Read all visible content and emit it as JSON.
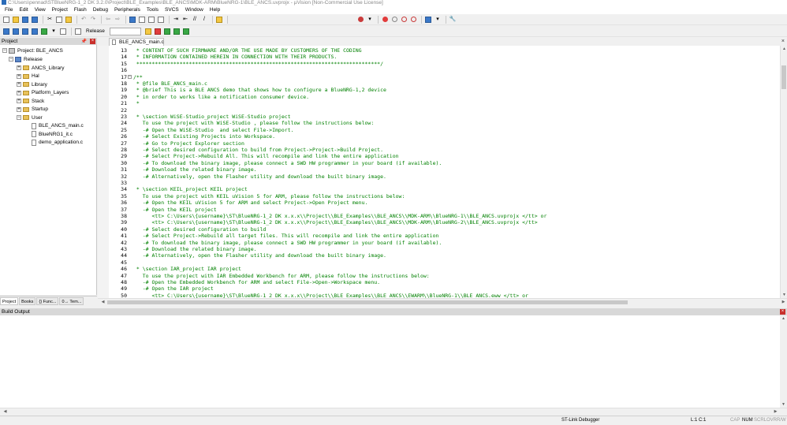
{
  "window": {
    "title": "C:\\Users\\pennad\\STBlueNRG-1_2 DK 3.2.0\\Project\\BLE_Examples\\BLE_ANCS\\MDK-ARM\\BlueNRG-1\\BLE_ANCS.uvprojx - µVision [Non-Commercial Use License]"
  },
  "menu": [
    "File",
    "Edit",
    "View",
    "Project",
    "Flash",
    "Debug",
    "Peripherals",
    "Tools",
    "SVCS",
    "Window",
    "Help"
  ],
  "toolbar": {
    "target_label": "Release"
  },
  "project_panel": {
    "title": "Project",
    "pin_icon": "📌",
    "close_icon": "×",
    "tree": [
      {
        "label": "Project: BLE_ANCS",
        "kind": "project",
        "expander": "−"
      },
      {
        "label": "Release",
        "kind": "target",
        "expander": "−"
      },
      {
        "label": "ANCS_Library",
        "kind": "folder",
        "expander": "+"
      },
      {
        "label": "Hal",
        "kind": "folder",
        "expander": "+"
      },
      {
        "label": "Library",
        "kind": "folder",
        "expander": "+"
      },
      {
        "label": "Platform_Layers",
        "kind": "folder",
        "expander": "+"
      },
      {
        "label": "Stack",
        "kind": "folder",
        "expander": "+"
      },
      {
        "label": "Startup",
        "kind": "folder",
        "expander": "+"
      },
      {
        "label": "User",
        "kind": "folder",
        "expander": "−"
      },
      {
        "label": "BLE_ANCS_main.c",
        "kind": "file",
        "expander": ""
      },
      {
        "label": "BlueNRG1_it.c",
        "kind": "file",
        "expander": ""
      },
      {
        "label": "demo_application.c",
        "kind": "file",
        "expander": ""
      }
    ],
    "tabs": [
      "Project",
      "Books",
      "{} Func...",
      "0→ Tem..."
    ]
  },
  "editor": {
    "tab_label": "BLE_ANCS_main.c",
    "close_icon": "×",
    "lines": [
      {
        "n": "13",
        "t": " * CONTENT OF SUCH FIRMWARE AND/OR THE USE MADE BY CUSTOMERS OF THE CODING"
      },
      {
        "n": "14",
        "t": " * INFORMATION CONTAINED HEREIN IN CONNECTION WITH THEIR PRODUCTS."
      },
      {
        "n": "15",
        "t": " *******************************************************************************/"
      },
      {
        "n": "16",
        "t": ""
      },
      {
        "n": "17",
        "t": "/**",
        "fold": "−"
      },
      {
        "n": "18",
        "t": " * @file BLE_ANCS_main.c"
      },
      {
        "n": "19",
        "t": " * @brief This is a BLE ANCS demo that shows how to configure a BlueNRG-1,2 device"
      },
      {
        "n": "20",
        "t": " * in order to works like a notification consumer device."
      },
      {
        "n": "21",
        "t": " *"
      },
      {
        "n": "22",
        "t": ""
      },
      {
        "n": "23",
        "t": " * \\section WiSE-Studio_project WiSE-Studio project"
      },
      {
        "n": "24",
        "t": "   To use the project with WiSE-Studio , please follow the instructions below:"
      },
      {
        "n": "25",
        "t": "   -# Open the WiSE-Studio  and select File->Import."
      },
      {
        "n": "26",
        "t": "   -# Select Existing Projects into Workspace."
      },
      {
        "n": "27",
        "t": "   -# Go to Project Explorer section"
      },
      {
        "n": "28",
        "t": "   -# Select desired configuration to build from Project->Project->Build Project."
      },
      {
        "n": "29",
        "t": "   -# Select Project->Rebuild All. This will recompile and link the entire application"
      },
      {
        "n": "30",
        "t": "   -# To download the binary image, please connect a SWD HW programmer in your board (if available)."
      },
      {
        "n": "31",
        "t": "   -# Download the related binary image."
      },
      {
        "n": "32",
        "t": "   -# Alternatively, open the Flasher utility and download the built binary image."
      },
      {
        "n": "33",
        "t": ""
      },
      {
        "n": "34",
        "t": " * \\section KEIL_project KEIL project"
      },
      {
        "n": "35",
        "t": "   To use the project with KEIL uVision 5 for ARM, please follow the instructions below:"
      },
      {
        "n": "36",
        "t": "   -# Open the KEIL uVision 5 for ARM and select Project->Open Project menu."
      },
      {
        "n": "37",
        "t": "   -# Open the KEIL project"
      },
      {
        "n": "38",
        "t": "      <tt> C:\\Users\\{username}\\ST\\BlueNRG-1_2 DK x.x.x\\\\Project\\\\BLE_Examples\\\\BLE_ANCS\\\\MDK-ARM\\\\BlueNRG-1\\\\BLE_ANCS.uvprojx </tt> or"
      },
      {
        "n": "39",
        "t": "      <tt> C:\\Users\\{username}\\ST\\BlueNRG-1_2 DK x.x.x\\\\Project\\\\BLE_Examples\\\\BLE_ANCS\\\\MDK-ARM\\\\BlueNRG-2\\\\BLE_ANCS.uvprojx </tt>"
      },
      {
        "n": "40",
        "t": "   -# Select desired configuration to build"
      },
      {
        "n": "41",
        "t": "   -# Select Project->Rebuild all target files. This will recompile and link the entire application"
      },
      {
        "n": "42",
        "t": "   -# To download the binary image, please connect a SWD HW programmer in your board (if available)."
      },
      {
        "n": "43",
        "t": "   -# Download the related binary image."
      },
      {
        "n": "44",
        "t": "   -# Alternatively, open the Flasher utility and download the built binary image."
      },
      {
        "n": "45",
        "t": ""
      },
      {
        "n": "46",
        "t": " * \\section IAR_project IAR project"
      },
      {
        "n": "47",
        "t": "   To use the project with IAR Embedded Workbench for ARM, please follow the instructions below:"
      },
      {
        "n": "48",
        "t": "   -# Open the Embedded Workbench for ARM and select File->Open->Workspace menu."
      },
      {
        "n": "49",
        "t": "   -# Open the IAR project"
      },
      {
        "n": "50",
        "t": "      <tt> C:\\Users\\{username}\\ST\\BlueNRG-1_2 DK x.x.x\\\\Project\\\\BLE_Examples\\\\BLE_ANCS\\\\EWARM\\\\BlueNRG-1\\\\BLE_ANCS.eww </tt> or"
      }
    ]
  },
  "build_output": {
    "title": "Build Output",
    "close_icon": "×"
  },
  "statusbar": {
    "debugger": "ST-Link Debugger",
    "position": "L:1 C:1",
    "cap": "CAP",
    "num": "NUM",
    "scrl": "SCRL",
    "ovr": "OVR",
    "rw": "R/W"
  }
}
